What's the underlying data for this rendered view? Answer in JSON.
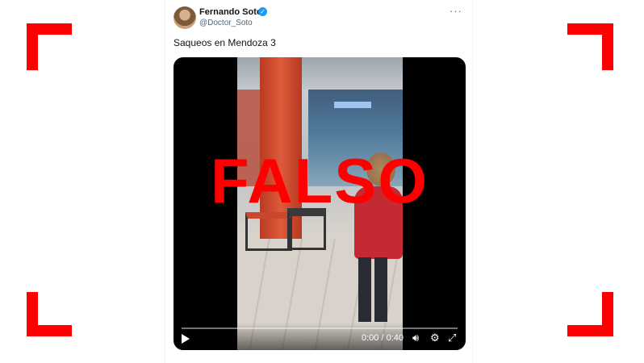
{
  "tweet": {
    "author_name": "Fernando Soto",
    "handle": "@Doctor_Soto",
    "text": "Saqueos en Mendoza 3",
    "more_label": "···"
  },
  "video": {
    "overlay_label": "FALSO",
    "time": "0:00 / 0:40",
    "progress_fraction": 0.0
  },
  "icons": {
    "verified": "verified-badge-icon",
    "play": "play-icon",
    "volume": "volume-icon",
    "settings": "gear-icon",
    "fullscreen": "expand-icon"
  },
  "colors": {
    "accent_red": "#ff0000",
    "verified_blue": "#1d9bf0",
    "text_primary": "#0f1419",
    "text_secondary": "#536471"
  }
}
